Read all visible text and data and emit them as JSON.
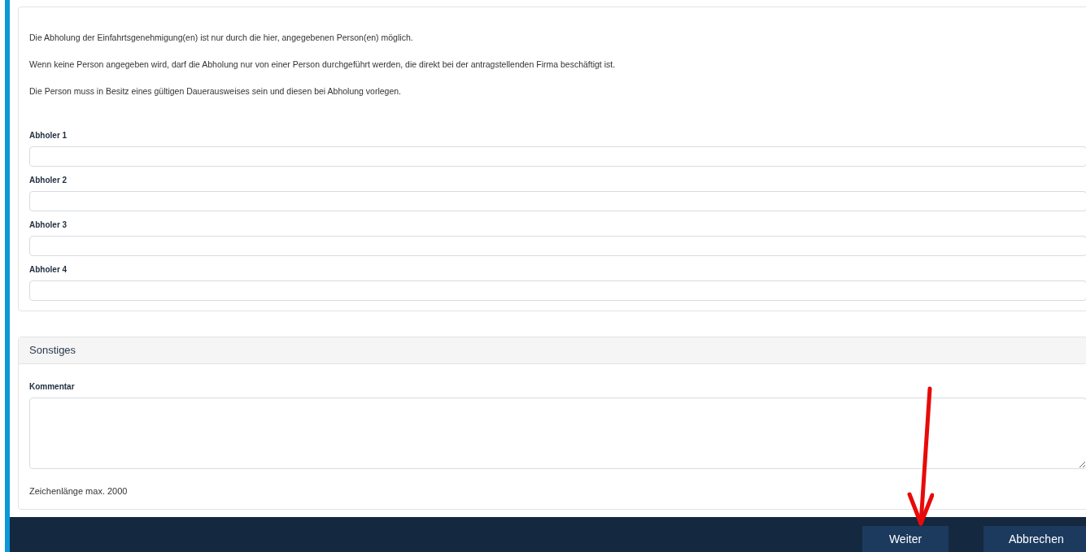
{
  "info_texts": [
    "Die Abholung der Einfahrtsgenehmigung(en) ist nur durch die hier, angegebenen Person(en) möglich.",
    "Wenn keine Person angegeben wird, darf die Abholung nur von einer Person durchgeführt werden, die direkt bei der antragstellenden Firma beschäftigt ist.",
    "Die Person muss in Besitz eines gültigen Dauerausweises sein und diesen bei Abholung vorlegen."
  ],
  "pickup_fields": [
    {
      "label": "Abholer 1"
    },
    {
      "label": "Abholer 2"
    },
    {
      "label": "Abholer 3"
    },
    {
      "label": "Abholer 4"
    }
  ],
  "other_section": {
    "title": "Sonstiges",
    "comment_label": "Kommentar",
    "hint": "Zeichenlänge max. 2000"
  },
  "footer_buttons": [
    "Weiter",
    "Abbrechen"
  ]
}
